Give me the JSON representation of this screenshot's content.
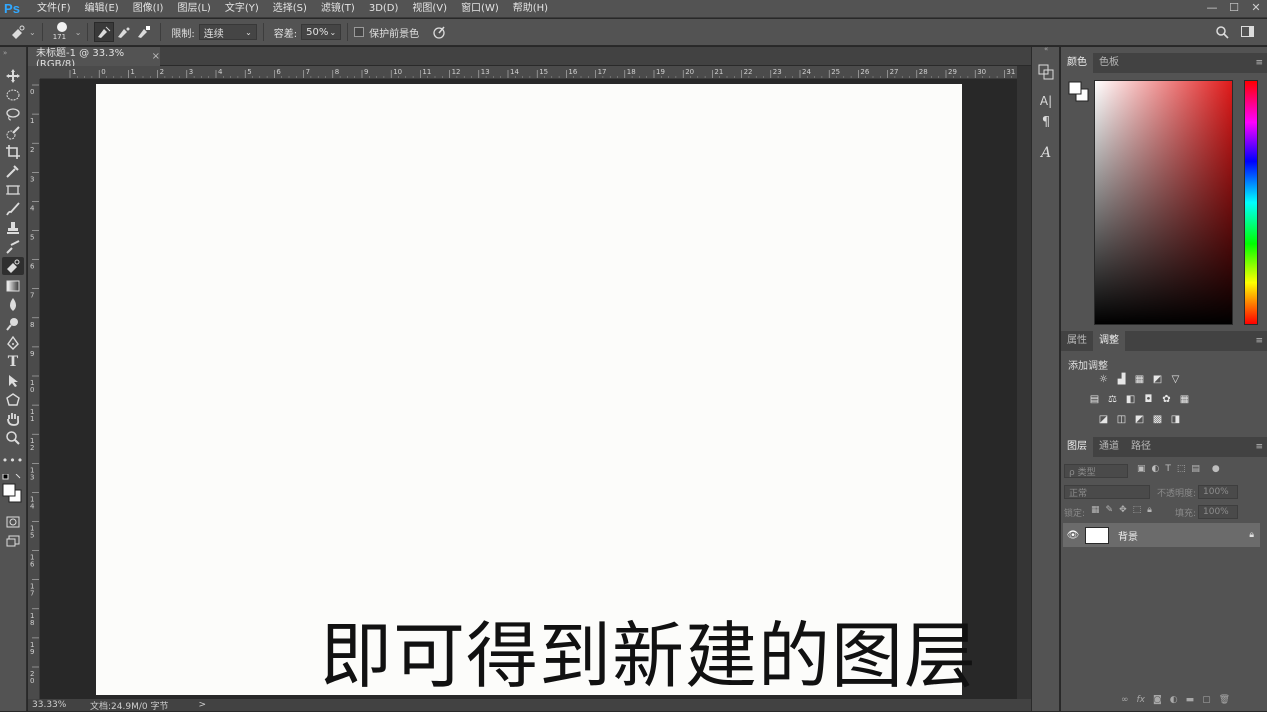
{
  "app": {
    "logo": "Ps"
  },
  "menu": [
    "文件(F)",
    "编辑(E)",
    "图像(I)",
    "图层(L)",
    "文字(Y)",
    "选择(S)",
    "滤镜(T)",
    "3D(D)",
    "视图(V)",
    "窗口(W)",
    "帮助(H)"
  ],
  "window_controls": [
    "—",
    "☐",
    "✕"
  ],
  "options": {
    "brush_size": "171",
    "limit_label": "限制:",
    "limit_value": "连续",
    "tolerance_label": "容差:",
    "tolerance_value": "50%",
    "protect_fg_label": "保护前景色"
  },
  "document": {
    "tab_label": "未标题-1 @ 33.3%(RGB/8)",
    "tab_close": "×",
    "caption": "即可得到新建的图层"
  },
  "ruler": {
    "top_ticks": [
      "1",
      "0",
      "1",
      "2",
      "3",
      "4",
      "5",
      "6",
      "7",
      "8",
      "9",
      "10",
      "11",
      "12",
      "13",
      "14",
      "15",
      "16",
      "17",
      "18",
      "19",
      "20",
      "21",
      "22",
      "23",
      "24",
      "25",
      "26",
      "27",
      "28",
      "29",
      "30",
      "31"
    ],
    "left_ticks": [
      "0",
      "1",
      "2",
      "3",
      "4",
      "5",
      "6",
      "7",
      "8",
      "9",
      "10",
      "11",
      "12",
      "13",
      "14",
      "15",
      "16",
      "17",
      "18",
      "19",
      "20"
    ]
  },
  "status": {
    "zoom": "33.33%",
    "doc_info": "文档:24.9M/0 字节",
    "arrow": ">"
  },
  "panels": {
    "color": {
      "tabs": [
        "颜色",
        "色板"
      ],
      "active": 0
    },
    "adjust": {
      "tabs": [
        "属性",
        "调整"
      ],
      "active": 1,
      "heading": "添加调整"
    },
    "layers": {
      "tabs": [
        "图层",
        "通道",
        "路径"
      ],
      "active": 0,
      "filter_placeholder": "ρ 类型",
      "blend_mode": "正常",
      "opacity_label": "不透明度:",
      "opacity_value": "100%",
      "lock_label": "锁定:",
      "fill_label": "填充:",
      "fill_value": "100%",
      "items": [
        {
          "name": "背景",
          "visible": true,
          "locked": true
        }
      ]
    }
  },
  "colors": {
    "accent": "#31a8ff",
    "ui_bg": "#535353",
    "pasteboard": "#282828",
    "canvas": "#fcfcfa"
  }
}
